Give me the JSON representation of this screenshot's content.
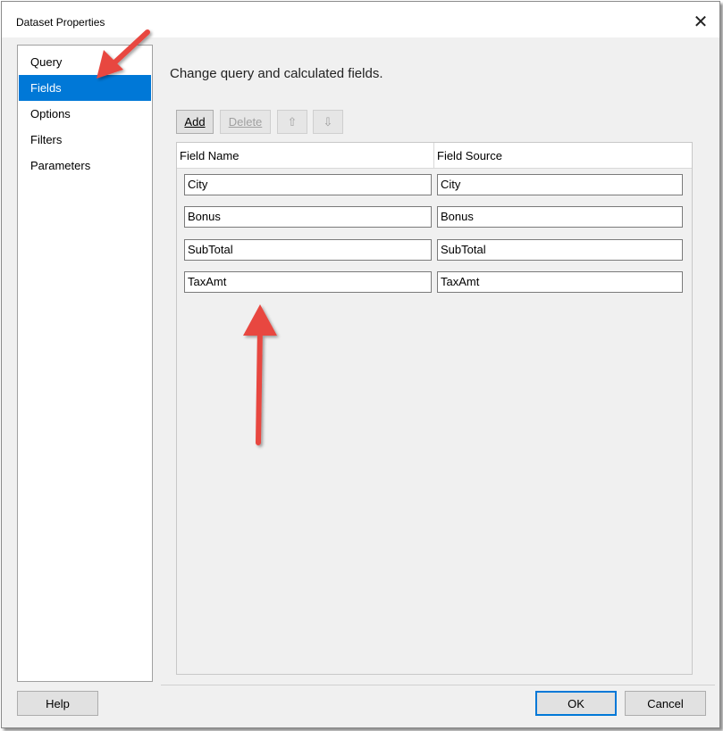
{
  "window": {
    "title": "Dataset Properties",
    "close_glyph": "✕"
  },
  "sidebar": {
    "items": [
      {
        "label": "Query",
        "selected": false
      },
      {
        "label": "Fields",
        "selected": true
      },
      {
        "label": "Options",
        "selected": false
      },
      {
        "label": "Filters",
        "selected": false
      },
      {
        "label": "Parameters",
        "selected": false
      }
    ]
  },
  "main": {
    "title": "Change query and calculated fields."
  },
  "toolbar": {
    "add_label": "Add",
    "delete_label": "Delete",
    "move_up_glyph": "⇧",
    "move_down_glyph": "⇩"
  },
  "grid": {
    "headers": [
      "Field Name",
      "Field Source"
    ],
    "rows": [
      {
        "field_name": "City",
        "field_source": "City"
      },
      {
        "field_name": "Bonus",
        "field_source": "Bonus"
      },
      {
        "field_name": "SubTotal",
        "field_source": "SubTotal"
      },
      {
        "field_name": "TaxAmt",
        "field_source": "TaxAmt"
      }
    ]
  },
  "footer": {
    "help_label": "Help",
    "ok_label": "OK",
    "cancel_label": "Cancel"
  },
  "colors": {
    "selection": "#0078d7",
    "annotation_arrow": "#e8473f"
  }
}
